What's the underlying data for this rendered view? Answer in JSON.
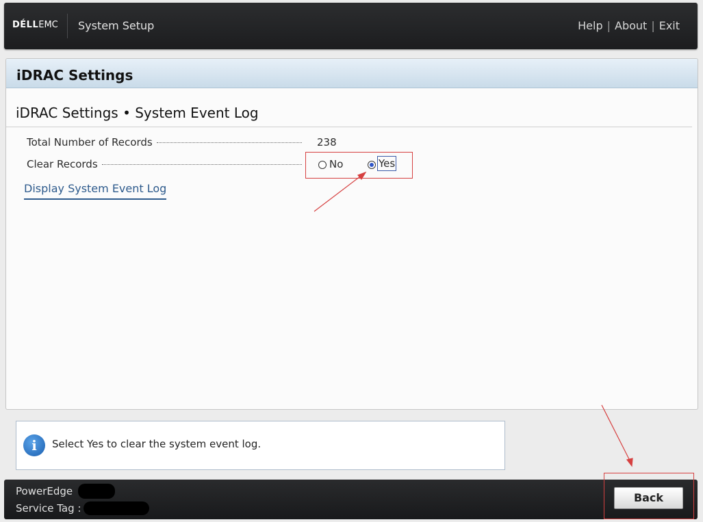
{
  "header": {
    "brand_bold": "DÉLL",
    "brand_rest": "EMC",
    "title": "System Setup",
    "links": [
      "Help",
      "About",
      "Exit"
    ]
  },
  "panel": {
    "title": "iDRAC Settings",
    "section_title": "iDRAC Settings • System Event Log"
  },
  "fields": {
    "total_records_label": "Total Number of Records",
    "total_records_value": "238",
    "clear_records_label": "Clear Records",
    "clear_options": [
      "No",
      "Yes"
    ],
    "clear_selected": "Yes"
  },
  "display_link": "Display System Event Log",
  "info": {
    "text": "Select Yes to clear the system event log."
  },
  "footer": {
    "model_label": "PowerEdge",
    "service_tag_label": "Service Tag :",
    "back_button": "Back"
  },
  "colors": {
    "annotation": "#d64040",
    "link": "#2d5a8c",
    "radio_selected": "#2f56c8"
  }
}
